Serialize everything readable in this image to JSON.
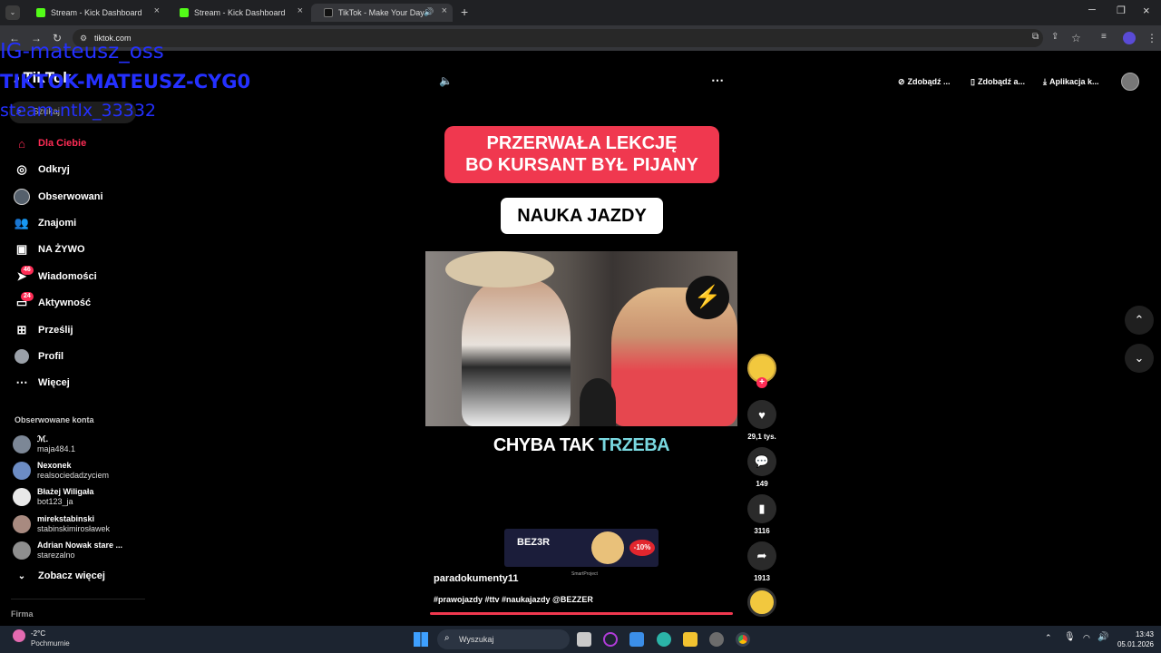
{
  "browser": {
    "tabs": [
      {
        "title": "Stream - Kick Dashboard"
      },
      {
        "title": "Stream - Kick Dashboard"
      },
      {
        "title": "TikTok - Make Your Day"
      }
    ],
    "url": "tiktok.com",
    "new_tab": "+"
  },
  "overlay": {
    "line1": "IG-mateusz_oss",
    "line2": "TIKTOK-MATEUSZ-CYG0",
    "line3": "steam-ntlx_33332"
  },
  "tiktok": {
    "logo": "TikTok",
    "search_placeholder": "Szukaj",
    "nav": [
      {
        "label": "Dla Ciebie",
        "icon": "home-icon",
        "color": "#fe2c55"
      },
      {
        "label": "Odkryj",
        "icon": "compass-icon"
      },
      {
        "label": "Obserwowani",
        "icon": "following-icon"
      },
      {
        "label": "Znajomi",
        "icon": "friends-icon"
      },
      {
        "label": "NA ŻYWO",
        "icon": "live-icon"
      },
      {
        "label": "Wiadomości",
        "icon": "messages-icon",
        "badge": "46"
      },
      {
        "label": "Aktywność",
        "icon": "activity-icon",
        "badge": "24"
      },
      {
        "label": "Prześlij",
        "icon": "upload-icon"
      },
      {
        "label": "Profil",
        "icon": "profile-icon"
      },
      {
        "label": "Więcej",
        "icon": "more-icon"
      }
    ],
    "followed_header": "Obserwowane konta",
    "followed": [
      {
        "name": "ℳ.",
        "handle": "maja484.1"
      },
      {
        "name": "Nexonek",
        "handle": "realsociedadzyciem"
      },
      {
        "name": "Błażej Wiligała",
        "handle": "bot123_ja"
      },
      {
        "name": "mirekstabinski",
        "handle": "stabinskimirosławek"
      },
      {
        "name": "Adrian Nowak stare ...",
        "handle": "starezalno"
      }
    ],
    "see_more": "Zobacz więcej",
    "footer": "Firma",
    "top_buttons": [
      "Zdobądź ...",
      "Zdobądź a...",
      "Aplikacja k..."
    ],
    "video": {
      "headline1": "PRZERWAŁA LEKCJĘ",
      "headline2": "BO KURSANT BYŁ PIJANY",
      "tag": "NAUKA JAZDY",
      "subtitle_a": "CHYBA TAK ",
      "subtitle_b": "TRZEBA",
      "ad_brand": "BEZ3R",
      "ad_discount": "-10%",
      "ad_sponsor": "SmartProject",
      "author": "paradokumenty11",
      "hashtags": "#prawojazdy #ttv #naukajazdy @BEZZER"
    },
    "actions": {
      "likes": "29,1 tys.",
      "comments": "149",
      "saves": "3116",
      "shares": "1913"
    }
  },
  "taskbar": {
    "weather_temp": "-2°C",
    "weather_desc": "Pochmurnie",
    "search": "Wyszukaj",
    "time": "13:43",
    "date": "05.01.2026"
  }
}
